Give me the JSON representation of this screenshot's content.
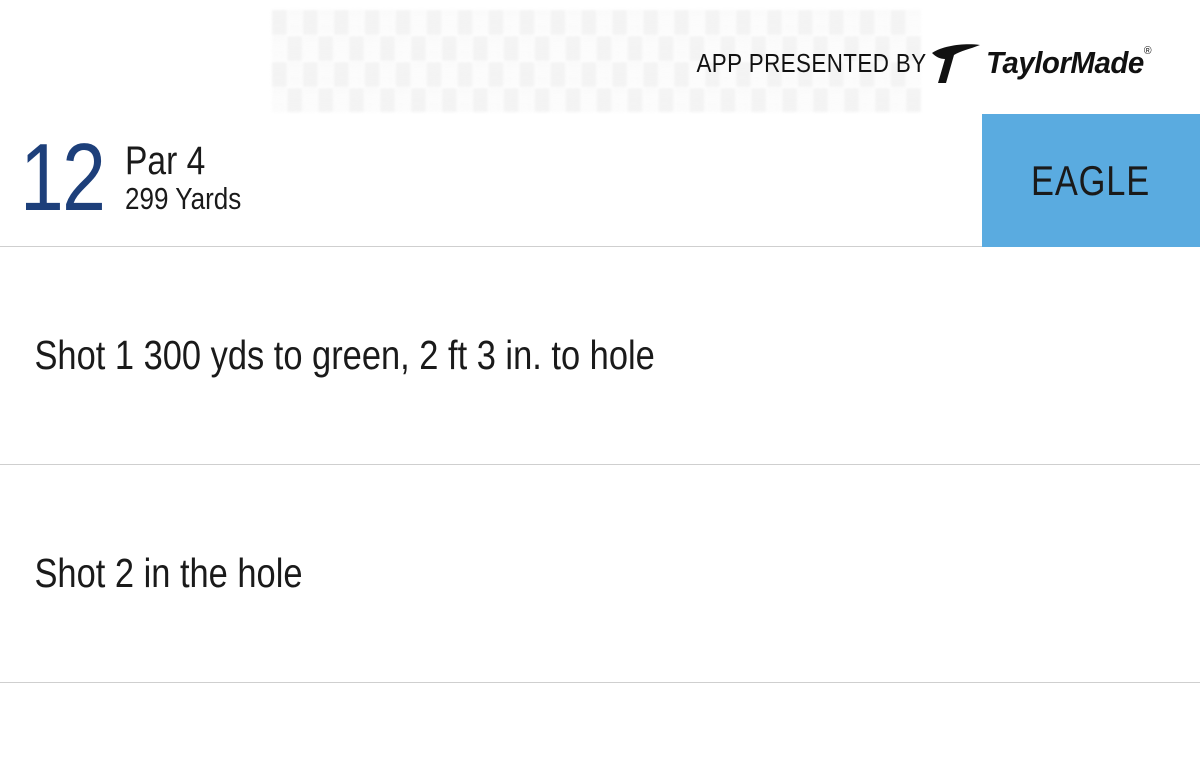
{
  "sponsor": {
    "label": "APP PRESENTED BY",
    "brand": "TaylorMade",
    "registered": "®",
    "logo_icon": "taylormade-t-logo-icon"
  },
  "hole": {
    "number": "12",
    "par": "Par 4",
    "yards": "299 Yards",
    "result": "EAGLE",
    "result_color": "#5aabe0",
    "number_color": "#1d3f7a"
  },
  "shots": [
    {
      "text": "Shot 1 300 yds to green, 2 ft 3 in. to hole"
    },
    {
      "text": "Shot 2 in the hole"
    }
  ]
}
